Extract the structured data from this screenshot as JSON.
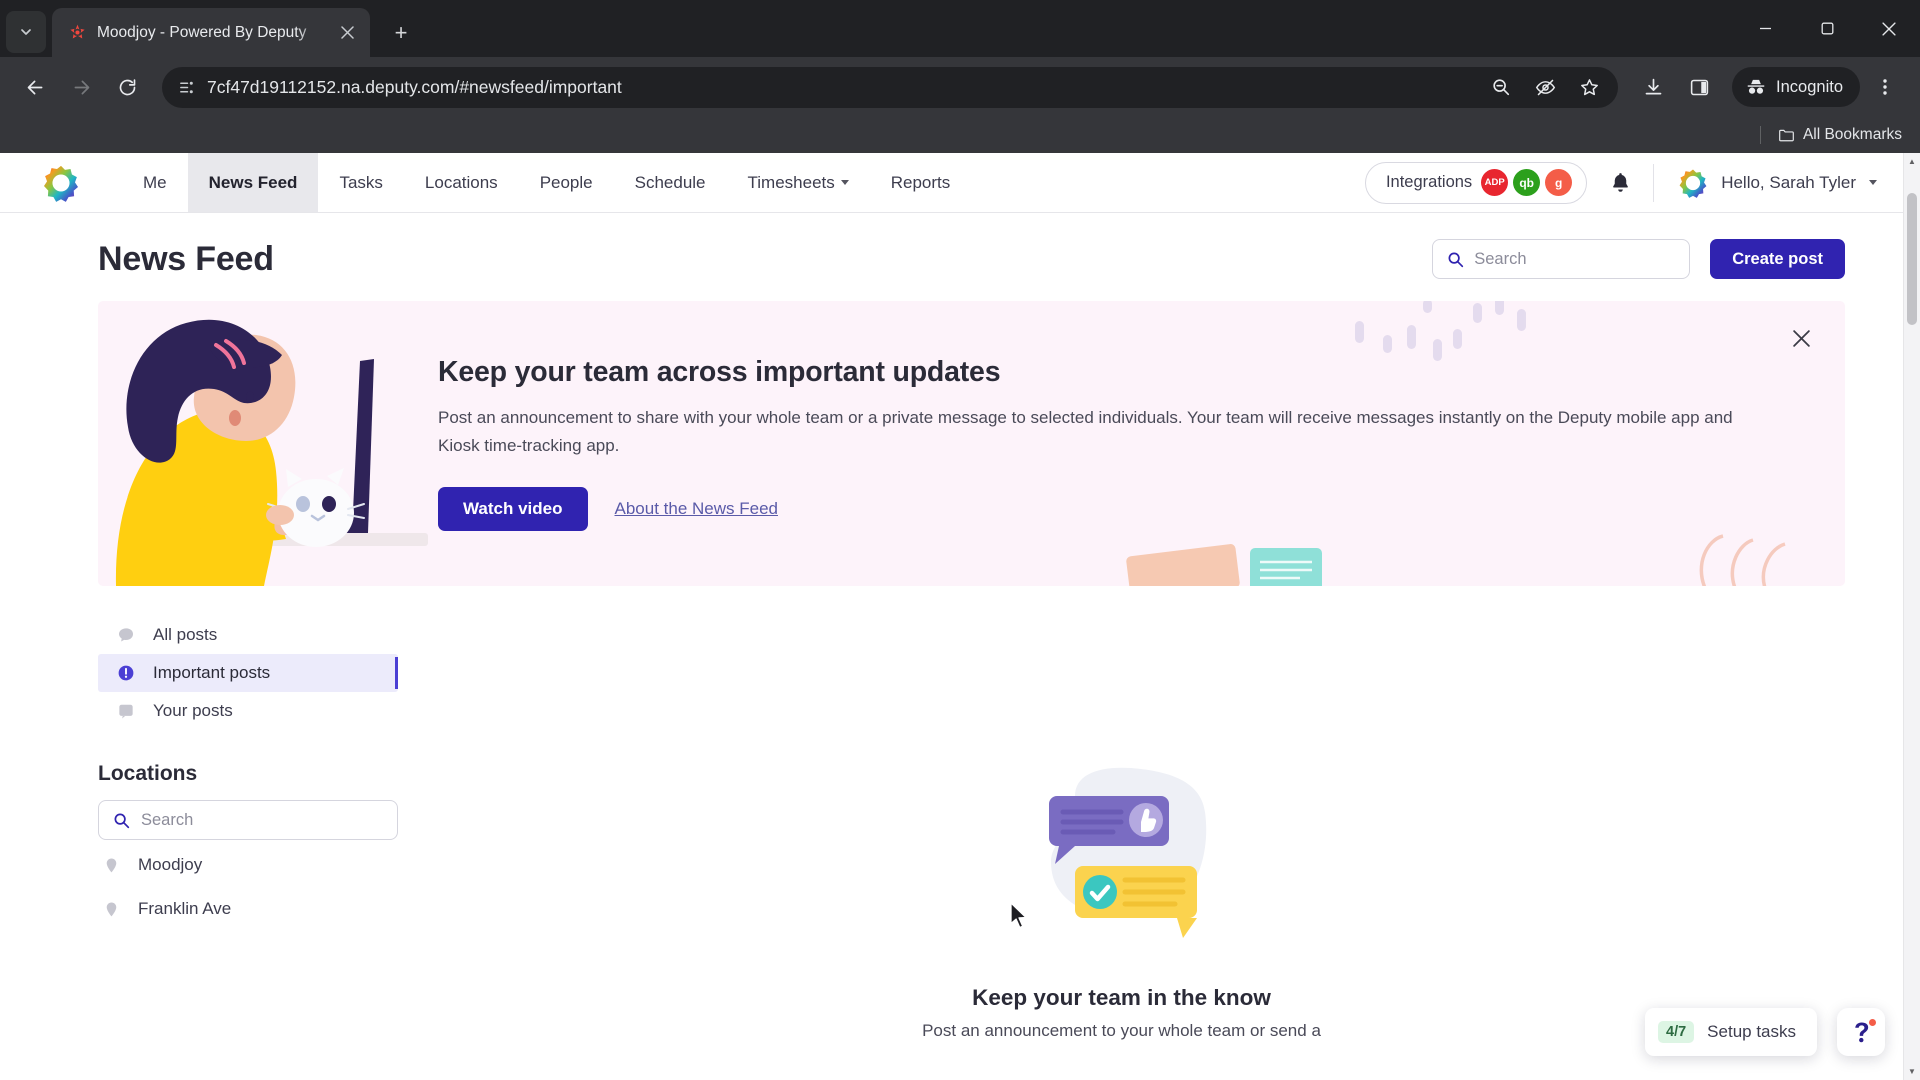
{
  "browser": {
    "tab": {
      "title": "Moodjoy - Powered By Deputy",
      "favicon_name": "moodjoy-favicon"
    },
    "new_tab_label": "+",
    "url": "7cf47d19112152.na.deputy.com/#newsfeed/important",
    "profile_label": "Incognito",
    "bookmarks_label": "All Bookmarks",
    "toolbar_icons": [
      "back-icon",
      "forward-icon",
      "reload-icon",
      "site-info-icon",
      "zoom-out-icon",
      "tracking-protection-icon",
      "bookmark-star-icon",
      "downloads-icon",
      "side-panel-icon",
      "chrome-menu-icon"
    ],
    "window_controls": [
      "minimize",
      "maximize",
      "close"
    ]
  },
  "appnav": {
    "logo_name": "deputy-logo",
    "items": [
      {
        "label": "Me",
        "active": false,
        "dropdown": false
      },
      {
        "label": "News Feed",
        "active": true,
        "dropdown": false
      },
      {
        "label": "Tasks",
        "active": false,
        "dropdown": false
      },
      {
        "label": "Locations",
        "active": false,
        "dropdown": false
      },
      {
        "label": "People",
        "active": false,
        "dropdown": false
      },
      {
        "label": "Schedule",
        "active": false,
        "dropdown": false
      },
      {
        "label": "Timesheets",
        "active": false,
        "dropdown": true
      },
      {
        "label": "Reports",
        "active": false,
        "dropdown": false
      }
    ],
    "integrations_label": "Integrations",
    "integration_badges": [
      {
        "name": "adp-badge",
        "text": "ADP",
        "color": "#e8262f"
      },
      {
        "name": "quickbooks-badge",
        "text": "qb",
        "color": "#2ca01c"
      },
      {
        "name": "gusto-badge",
        "text": "g",
        "color": "#f45d48"
      }
    ],
    "notifications_icon": "bell-icon",
    "user_greeting": "Hello, Sarah Tyler",
    "user_avatar_name": "user-avatar"
  },
  "header": {
    "title": "News Feed",
    "search_placeholder": "Search",
    "search_value": "",
    "create_post_label": "Create post"
  },
  "banner": {
    "heading": "Keep your team across important updates",
    "body": "Post an announcement to share with your whole team or a private message to selected individuals. Your team will receive messages instantly on the Deputy mobile app and Kiosk time-tracking app.",
    "watch_video_label": "Watch video",
    "about_link_label": "About the News Feed",
    "close_label": "✕",
    "background_color": "#fdf3fa",
    "accent_color": "#3023b0",
    "illustration_name": "woman-at-laptop-with-cat-illustration"
  },
  "sidebar": {
    "filters": [
      {
        "label": "All posts",
        "icon": "comment-icon",
        "active": false
      },
      {
        "label": "Important posts",
        "icon": "important-alert-icon",
        "active": true
      },
      {
        "label": "Your posts",
        "icon": "note-icon",
        "active": false
      }
    ],
    "locations_title": "Locations",
    "locations_search_placeholder": "Search",
    "locations_search_value": "",
    "locations": [
      {
        "label": "Moodjoy",
        "icon": "pin-icon"
      },
      {
        "label": "Franklin Ave",
        "icon": "pin-icon"
      }
    ]
  },
  "empty_state": {
    "illustration_name": "chat-bubbles-illustration",
    "title": "Keep your team in the know",
    "subtitle": "Post an announcement to your whole team or send a"
  },
  "floating": {
    "setup_count": "4/7",
    "setup_label": "Setup tasks",
    "help_icon": "question-mark-icon"
  }
}
